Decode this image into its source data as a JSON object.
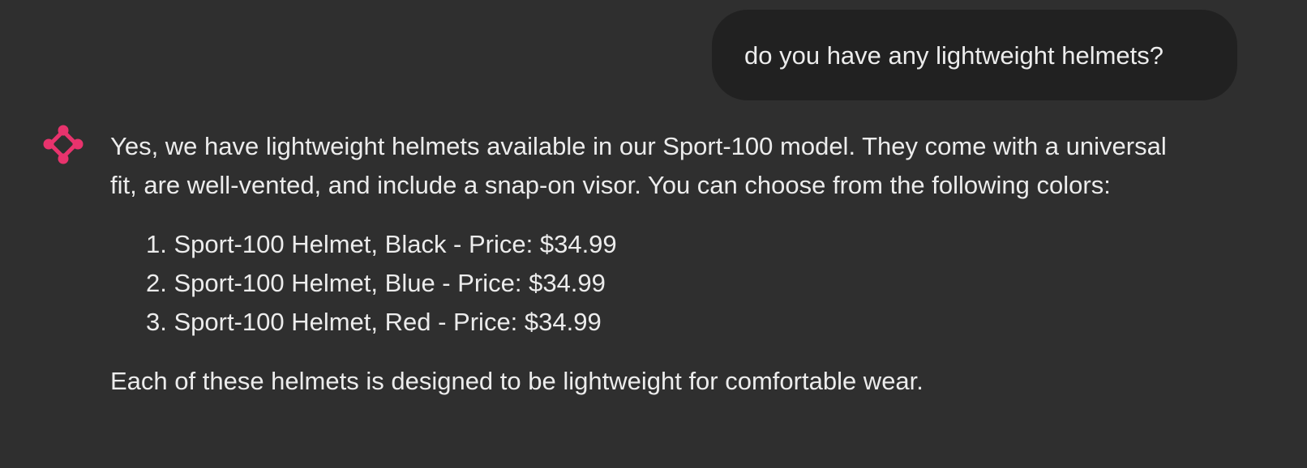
{
  "user_message": {
    "text": "do you have any lightweight helmets?"
  },
  "assistant_message": {
    "avatar_icon": "sparkle-logo-icon",
    "accent_color": "#e8336d",
    "intro": "Yes, we have lightweight helmets available in our Sport-100 model. They come with a universal fit, are well-vented, and include a snap-on visor. You can choose from the following colors:",
    "items": [
      "1. Sport-100 Helmet, Black - Price: $34.99",
      "2. Sport-100 Helmet, Blue - Price: $34.99",
      "3. Sport-100 Helmet, Red - Price: $34.99"
    ],
    "closing": "Each of these helmets is designed to be lightweight for comfortable wear."
  }
}
